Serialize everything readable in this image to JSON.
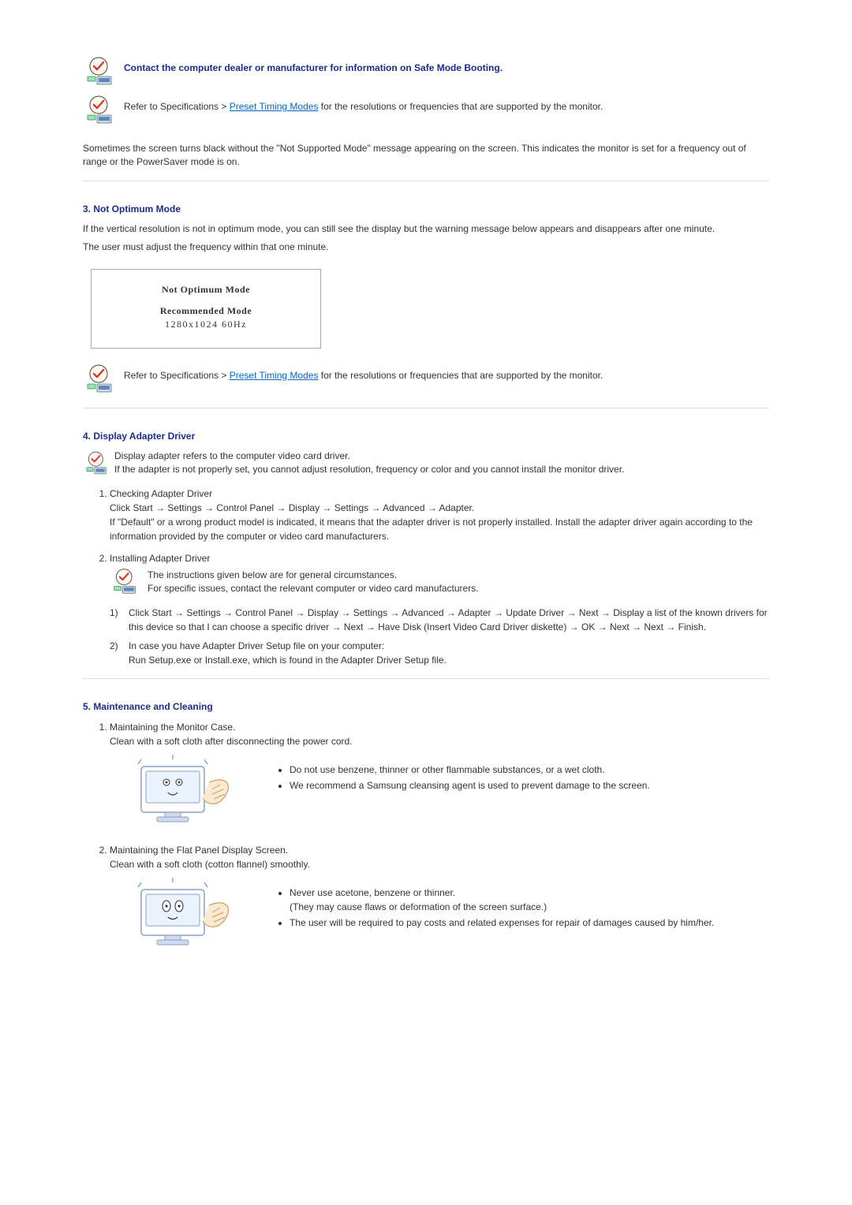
{
  "tip1_text": "Contact the computer dealer or manufacturer for information on Safe Mode Booting.",
  "tip2_pre": "Refer to Specifications > ",
  "tip2_link": "Preset Timing Modes",
  "tip2_post": " for the resolutions or frequencies that are supported by the monitor.",
  "sometimes": "Sometimes the screen turns black without the \"Not Supported Mode\" message appearing on the screen. This indicates the monitor is set for a frequency out of range or the PowerSaver mode is on.",
  "sec3_title": "3. Not Optimum Mode",
  "sec3_p1": "If the vertical resolution is not in optimum mode, you can still see the display but the warning message below appears and disappears after one minute.",
  "sec3_p2": "The user must adjust the frequency within that one minute.",
  "modebox_line1": "Not Optimum Mode",
  "modebox_line2": "Recommended Mode",
  "modebox_line3": "1280x1024   60Hz",
  "tip3_pre": "Refer to Specifications > ",
  "tip3_link": "Preset Timing Modes",
  "tip3_post": " for the resolutions or frequencies that are supported by the monitor.",
  "sec4_title": "4. Display Adapter Driver",
  "sec4_tip_l1": "Display adapter refers to the computer video card driver.",
  "sec4_tip_l2": "If the adapter is not properly set, you cannot adjust resolution, frequency or color and you cannot install the monitor driver.",
  "sec4_li1_title": "Checking Adapter Driver",
  "sec4_li1_path_pre": "Click Start ",
  "sec4_li1_path_parts": [
    "Settings",
    "Control Panel",
    "Display",
    "Settings",
    "Advanced",
    "Adapter."
  ],
  "sec4_li1_after": "If \"Default\" or a wrong product model is indicated, it means that the adapter driver is not properly installed. Install the adapter driver again according to the information provided by the computer or video card manufacturers.",
  "sec4_li2_title": "Installing Adapter Driver",
  "sec4_li2_tip_l1": "The instructions given below are for general circumstances.",
  "sec4_li2_tip_l2": "For specific issues, contact the relevant computer or video card manufacturers.",
  "sec4_step1_lead": "Click Start ",
  "sec4_step1_a": [
    "Settings",
    "Control Panel",
    "Display",
    "Settings",
    "Advanced",
    "Adapter",
    "Update Driver",
    "Next",
    "Display a list of the known drivers for this device so that I can choose a specific driver",
    "Next",
    "Have Disk (Insert Video Card Driver diskette)",
    "OK",
    "Next",
    "Next",
    "Finish."
  ],
  "sec4_step2_l1": "In case you have Adapter Driver Setup file on your computer:",
  "sec4_step2_l2": "Run Setup.exe or Install.exe, which is found in the Adapter Driver Setup file.",
  "sec5_title": "5. Maintenance and Cleaning",
  "sec5_li1_l1": "Maintaining the Monitor Case.",
  "sec5_li1_l2": "Clean with a soft cloth after disconnecting the power cord.",
  "sec5_li1_b1": "Do not use benzene, thinner or other flammable substances, or a wet cloth.",
  "sec5_li1_b2": "We recommend a Samsung cleansing agent is used to prevent damage to the screen.",
  "sec5_li2_l1": "Maintaining the Flat Panel Display Screen.",
  "sec5_li2_l2": "Clean with a soft cloth (cotton flannel) smoothly.",
  "sec5_li2_b1a": "Never use acetone, benzene or thinner.",
  "sec5_li2_b1b": "(They may cause flaws or deformation of the screen surface.)",
  "sec5_li2_b2": "The user will be required to pay costs and related expenses for repair of damages caused by him/her.",
  "arrow_glyph": "→"
}
